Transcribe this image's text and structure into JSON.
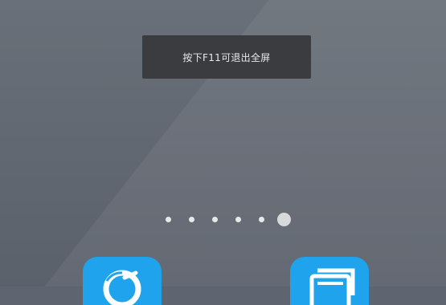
{
  "toast": {
    "text": "按下F11可退出全屏"
  },
  "page_indicator": {
    "page_count": 6,
    "current_page": 6
  },
  "dock": {
    "apps": [
      {
        "icon": "browser-icon",
        "color": "#1ea3ec"
      },
      {
        "icon": "files-icon",
        "color": "#1ea3ec"
      }
    ]
  }
}
